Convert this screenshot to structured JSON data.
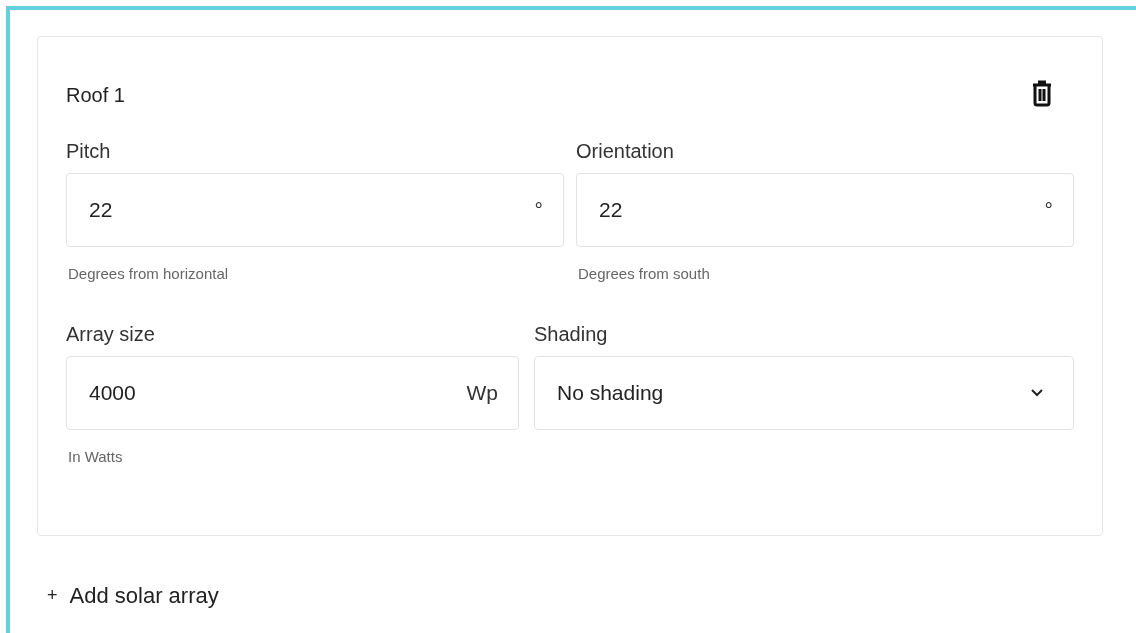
{
  "array": {
    "title": "Roof 1",
    "rows": [
      [
        {
          "kind": "number",
          "label": "Pitch",
          "value": "22",
          "unit": "°",
          "hint": "Degrees from horizontal"
        },
        {
          "kind": "number",
          "label": "Orientation",
          "value": "22",
          "unit": "°",
          "hint": "Degrees from south"
        }
      ],
      [
        {
          "kind": "number",
          "label": "Array size",
          "value": "4000",
          "unit": "Wp",
          "hint": "In Watts"
        },
        {
          "kind": "select",
          "label": "Shading",
          "value": "No shading"
        }
      ]
    ]
  },
  "add_button": {
    "icon": "+",
    "label": "Add solar array"
  }
}
